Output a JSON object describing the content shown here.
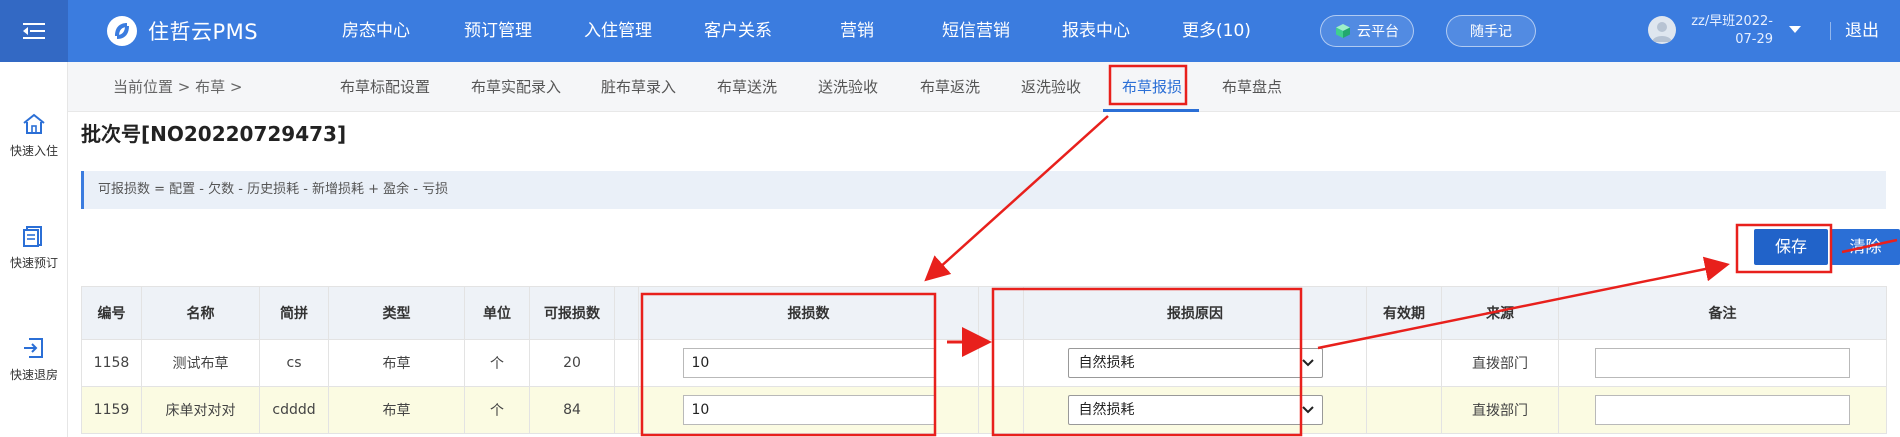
{
  "header": {
    "logo_text": "住哲云PMS",
    "nav": [
      "房态中心",
      "预订管理",
      "入住管理",
      "客户关系",
      "营销",
      "短信营销",
      "报表中心",
      "更多(10)"
    ],
    "cloud_platform": "云平台",
    "quick_note": "随手记",
    "user_line1": "zz/早班2022-",
    "user_line2": "07-29",
    "logout": "退出"
  },
  "sidebar": {
    "items": [
      {
        "label": "快速入住",
        "icon": "home-icon"
      },
      {
        "label": "快速预订",
        "icon": "booking-icon"
      },
      {
        "label": "快速退房",
        "icon": "checkout-icon"
      }
    ]
  },
  "breadcrumb": {
    "text": "当前位置 > 布草 >"
  },
  "tabs": [
    "布草标配设置",
    "布草实配录入",
    "脏布草录入",
    "布草送洗",
    "送洗验收",
    "布草返洗",
    "返洗验收",
    "布草报损",
    "布草盘点"
  ],
  "active_tab": "布草报损",
  "batch": {
    "title": "批次号[NO20220729473]"
  },
  "formula": "可报损数 = 配置 - 欠数 - 历史损耗 - 新增损耗 + 盈余 - 亏损",
  "buttons": {
    "save": "保存",
    "clear": "清除"
  },
  "table": {
    "headers": [
      "编号",
      "名称",
      "简拼",
      "类型",
      "单位",
      "可报损数",
      "",
      "报损数",
      "",
      "报损原因",
      "有效期",
      "来源",
      "备注"
    ],
    "rows": [
      {
        "id": "1158",
        "name": "测试布草",
        "pinyin": "cs",
        "type": "布草",
        "unit": "个",
        "available": "20",
        "report_qty": "10",
        "reason": "自然损耗",
        "expiry": "",
        "source": "直拨部门",
        "remark": ""
      },
      {
        "id": "1159",
        "name": "床单对对对",
        "pinyin": "cdddd",
        "type": "布草",
        "unit": "个",
        "available": "84",
        "report_qty": "10",
        "reason": "自然损耗",
        "expiry": "",
        "source": "直拨部门",
        "remark": ""
      }
    ]
  },
  "colors": {
    "topbar": "#3b7cdf",
    "accent": "#2b6fd6",
    "annotation": "#e8201c",
    "row_highlight": "#fbfbe2"
  }
}
